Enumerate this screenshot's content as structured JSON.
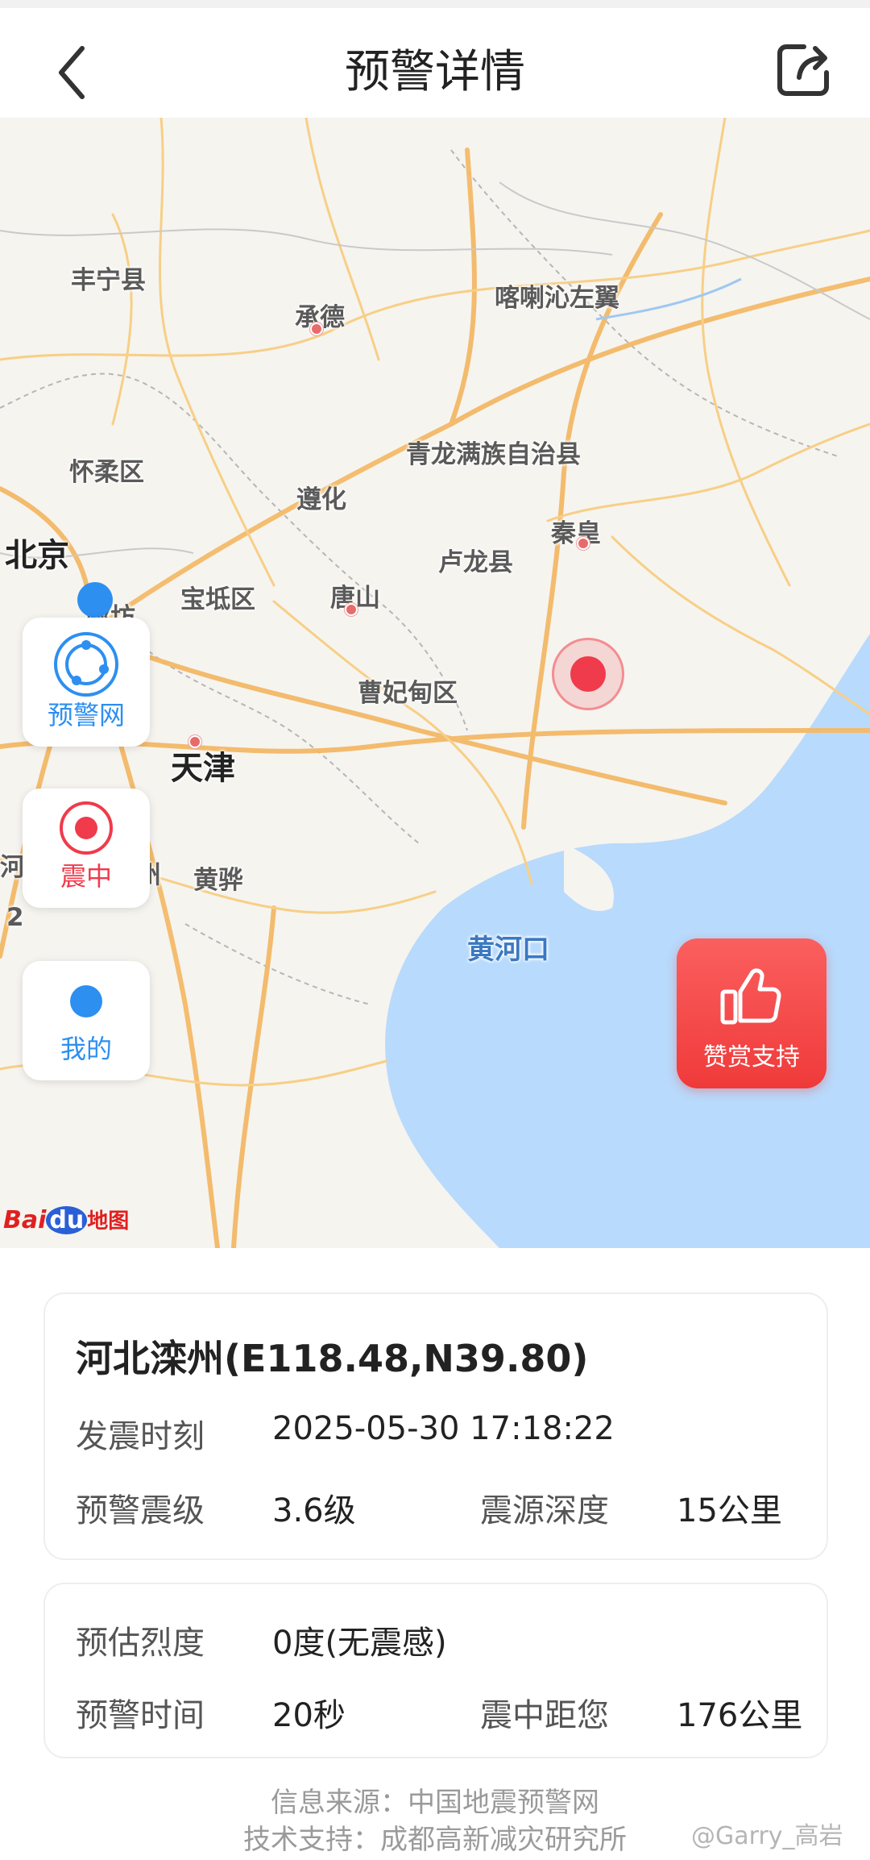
{
  "header": {
    "title": "预警详情",
    "back_icon": "back-arrow-icon",
    "share_icon": "share-icon"
  },
  "map": {
    "labels": {
      "fengning": "丰宁县",
      "chengde": "承德",
      "kalaqin": "喀喇沁左翼",
      "qinglong": "青龙满族自治县",
      "huairou": "怀柔区",
      "zunhua": "遵化",
      "beijing": "北京",
      "qinhuang": "秦皇",
      "lulong": "卢龙县",
      "baodi": "宝坻区",
      "tangshan": "唐山",
      "langfang": "廊坊",
      "caofeidian": "曹妃甸区",
      "bazhou": "霸州",
      "tianjin": "天津",
      "he": "河间",
      "cangzhou": "沧州",
      "huanghua": "黄骅",
      "huanghekou": "黄河口",
      "edge_number": "2"
    },
    "buttons": {
      "network": "预警网",
      "epicenter": "震中",
      "mine": "我的"
    },
    "reward": "赞赏支持",
    "logo_text": "Baidu地图",
    "colors": {
      "epicenter": "#ef3b4b",
      "user": "#2d8ff0",
      "sea": "#b8dafc",
      "road": "#f7c877"
    }
  },
  "quake": {
    "location": "河北滦州(E118.48,N39.80)",
    "time_label": "发震时刻",
    "time_value": "2025-05-30 17:18:22",
    "magnitude_label": "预警震级",
    "magnitude_value": "3.6级",
    "depth_label": "震源深度",
    "depth_value": "15公里"
  },
  "local": {
    "intensity_label": "预估烈度",
    "intensity_value": "0度(无震感)",
    "warning_time_label": "预警时间",
    "warning_time_value": "20秒",
    "distance_label": "震中距您",
    "distance_value": "176公里"
  },
  "footer": {
    "source": "信息来源：中国地震预警网",
    "support": "技术支持：成都高新减灾研究所",
    "watermark": "@Garry_高岩"
  }
}
